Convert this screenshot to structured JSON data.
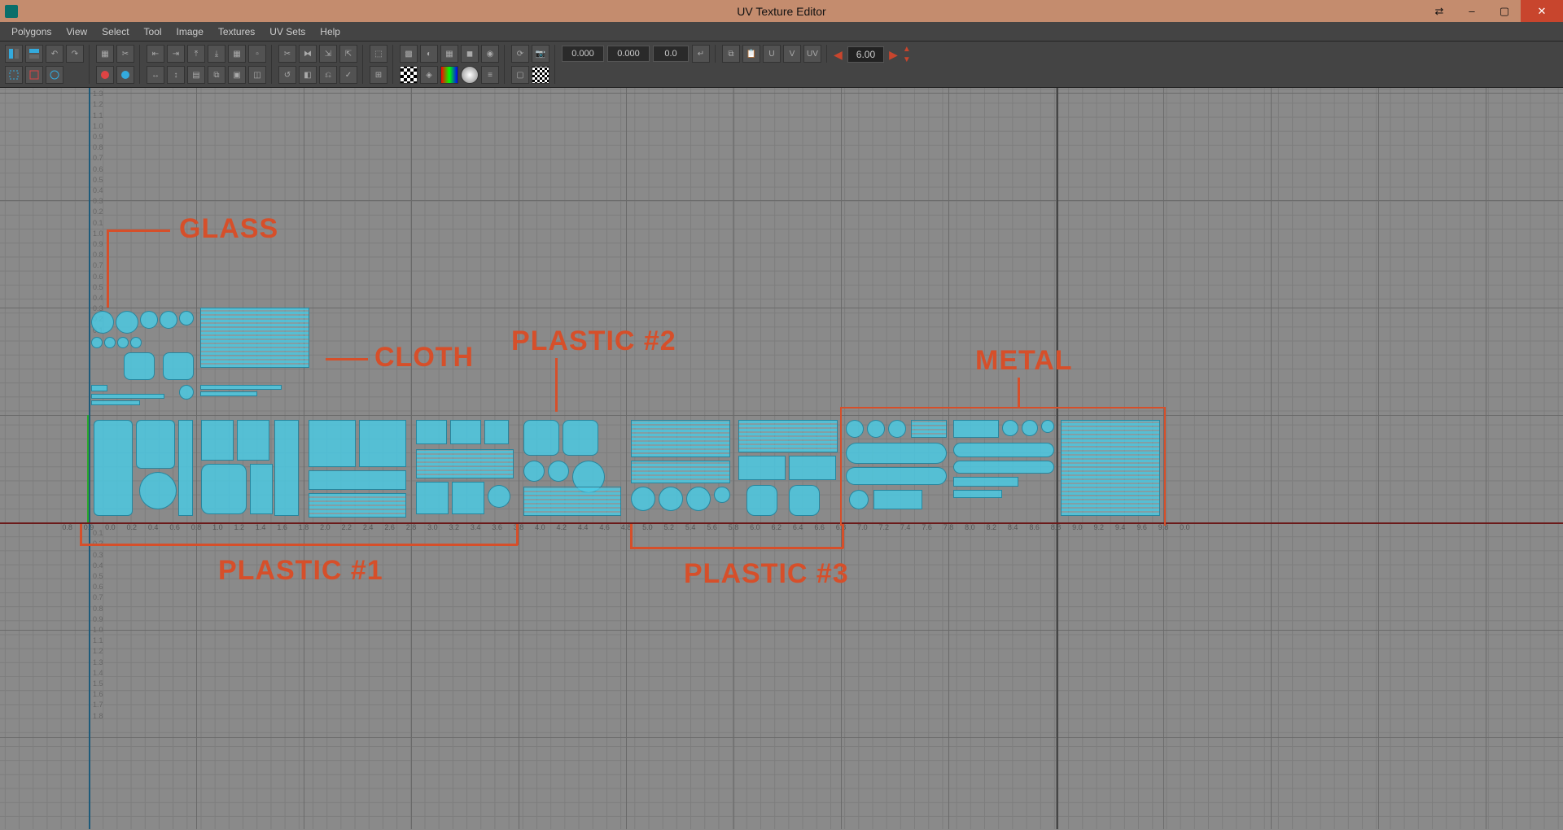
{
  "titlebar": {
    "title": "UV Texture Editor",
    "minimize_tip": "–",
    "maximize_tip": "▢",
    "close_tip": "✕"
  },
  "menubar": {
    "items": [
      "Polygons",
      "View",
      "Select",
      "Tool",
      "Image",
      "Textures",
      "UV Sets",
      "Help"
    ]
  },
  "toolbar": {
    "num_a": "0.000",
    "num_b": "0.000",
    "rot": "0.0",
    "spinner_value": "6.00"
  },
  "ruler": {
    "h_ticks": [
      "0.8",
      "0.9",
      "0.0",
      "0.2",
      "0.4",
      "0.6",
      "0.8",
      "1.0",
      "1.2",
      "1.4",
      "1.6",
      "1.8",
      "2.0",
      "2.2",
      "2.4",
      "2.6",
      "2.8",
      "3.0",
      "3.2",
      "3.4",
      "3.6",
      "3.8",
      "4.0",
      "4.2",
      "4.4",
      "4.6",
      "4.8",
      "5.0",
      "5.2",
      "5.4",
      "5.6",
      "5.8",
      "6.0",
      "6.2",
      "6.4",
      "6.6",
      "6.8",
      "7.0",
      "7.2",
      "7.4",
      "7.6",
      "7.8",
      "8.0",
      "8.2",
      "8.4",
      "8.6",
      "8.8",
      "9.0",
      "9.2",
      "9.4",
      "9.6",
      "9.8",
      "0.0"
    ],
    "v_ticks_top": [
      "1.3",
      "1.2",
      "1.1",
      "1.0",
      "0.9",
      "0.8",
      "0.7",
      "0.6",
      "0.5",
      "0.4",
      "0.3",
      "0.2",
      "0.1",
      "1.0",
      "0.9",
      "0.8",
      "0.7",
      "0.6",
      "0.5",
      "0.4",
      "0.3",
      "0.2",
      "0.1"
    ],
    "v_ticks_bot": [
      "0.1",
      "0.2",
      "0.3",
      "0.4",
      "0.5",
      "0.6",
      "0.7",
      "0.8",
      "0.9",
      "1.0",
      "1.1",
      "1.2",
      "1.3",
      "1.4",
      "1.5",
      "1.6",
      "1.7",
      "1.8"
    ]
  },
  "annotations": {
    "glass": "GLASS",
    "cloth": "CLOTH",
    "plastic1": "Plastic #1",
    "plastic2": "Plastic #2",
    "plastic3": "Plastic #3",
    "metal": "Metal"
  }
}
